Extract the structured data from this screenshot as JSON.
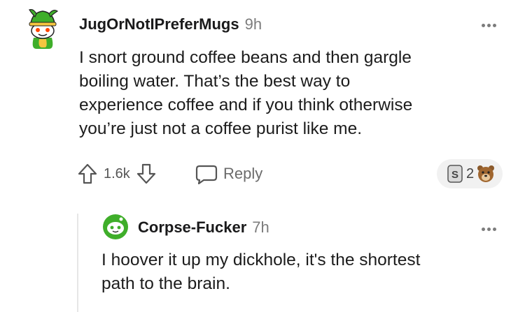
{
  "comment": {
    "username": "JugOrNotIPreferMugs",
    "time": "9h",
    "body_lines": [
      "I snort ground coffee beans and then gargle",
      "boiling water. That’s the best way to",
      "experience coffee and if you think otherwise",
      "you’re just not a coffee purist like me."
    ],
    "vote_count": "1.6k",
    "reply_label": "Reply",
    "award_count": "2",
    "avatar_icon": "snoo-avatar-green-hat-icon",
    "colors": {
      "avatar_green": "#3fae2a",
      "text": "#1c1c1c",
      "muted": "#7c7c7c"
    }
  },
  "reply": {
    "username": "Corpse-Fucker",
    "time": "7h",
    "body_lines": [
      "I hoover it up my dickhole, it's the shortest",
      "path to the brain."
    ],
    "avatar_icon": "snoo-avatar-green-icon"
  }
}
